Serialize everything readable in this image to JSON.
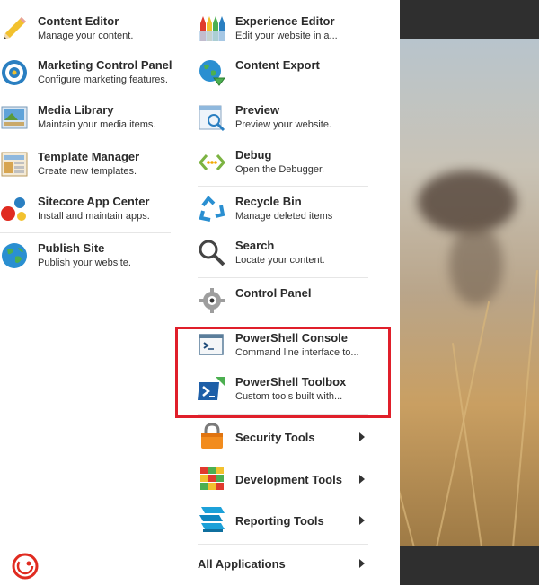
{
  "left_column": [
    {
      "title": "Content Editor",
      "desc": "Manage your content.",
      "icon": "pencil-icon"
    },
    {
      "title": "Marketing Control Panel",
      "desc": "Configure marketing features.",
      "icon": "target-icon"
    },
    {
      "title": "Media Library",
      "desc": "Maintain your media items.",
      "icon": "media-library-icon"
    },
    {
      "title": "Template Manager",
      "desc": "Create new templates.",
      "icon": "template-icon"
    },
    {
      "title": "Sitecore App Center",
      "desc": "Install and maintain apps.",
      "icon": "app-center-icon"
    },
    {
      "title": "Publish Site",
      "desc": "Publish your website.",
      "icon": "globe-icon"
    }
  ],
  "right_column": [
    {
      "title": "Experience Editor",
      "desc": "Edit your website in a...",
      "icon": "crayons-icon"
    },
    {
      "title": "Content Export",
      "desc": "",
      "icon": "export-globe-icon"
    },
    {
      "title": "Preview",
      "desc": "Preview your website.",
      "icon": "preview-icon"
    },
    {
      "title": "Debug",
      "desc": "Open the Debugger.",
      "icon": "debug-icon"
    },
    {
      "title": "Recycle Bin",
      "desc": "Manage deleted items",
      "icon": "recycle-icon"
    },
    {
      "title": "Search",
      "desc": "Locate your content.",
      "icon": "magnifier-icon"
    },
    {
      "title": "Control Panel",
      "desc": "",
      "icon": "gear-icon"
    },
    {
      "title": "PowerShell Console",
      "desc": "Command line interface to...",
      "icon": "console-icon"
    },
    {
      "title": "PowerShell Toolbox",
      "desc": "Custom tools built with...",
      "icon": "toolbox-icon"
    }
  ],
  "submenus": [
    {
      "title": "Security Tools",
      "icon": "lock-icon"
    },
    {
      "title": "Development Tools",
      "icon": "cube-icon"
    },
    {
      "title": "Reporting Tools",
      "icon": "reporting-icon"
    }
  ],
  "all_applications": "All Applications",
  "colors": {
    "highlight": "#e01f2a",
    "title": "#2b2b2b",
    "sitecore_logo": "#e02b20"
  }
}
